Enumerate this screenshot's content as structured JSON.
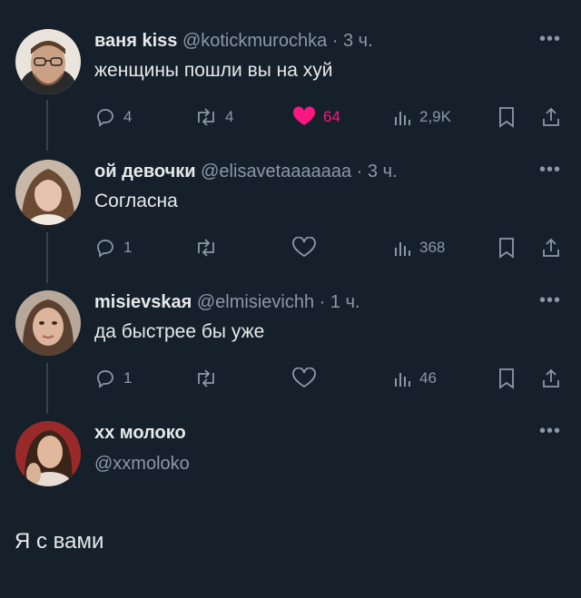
{
  "colors": {
    "background": "#15202b",
    "text": "#e7e9ea",
    "muted": "#8b98a5",
    "like": "#f91880",
    "line": "#38444d"
  },
  "tweets": [
    {
      "name": "ваня kiss",
      "handle": "@kotickmurochka",
      "time": "· 3 ч.",
      "text": "женщины пошли вы на хуй",
      "replies": "4",
      "retweets": "4",
      "likes": "64",
      "views": "2,9K",
      "liked": true
    },
    {
      "name": "ой девочки",
      "handle": "@elisavetaaaaaaa",
      "time": "· 3 ч.",
      "text": "Согласна",
      "replies": "1",
      "retweets": "",
      "likes": "",
      "views": "368"
    },
    {
      "name": "misievskaя",
      "handle": "@elmisievichh",
      "time": "· 1 ч.",
      "text": "да быстрее бы уже",
      "replies": "1",
      "retweets": "",
      "likes": "",
      "views": "46"
    }
  ],
  "main_tweet": {
    "name": "хх молоко",
    "handle": "@xxmoloko",
    "text": "Я с вами"
  },
  "icons": {
    "reply": "reply-icon",
    "retweet": "retweet-icon",
    "like": "heart-icon",
    "views": "views-icon",
    "bookmark": "bookmark-icon",
    "share": "share-icon",
    "more": "more-icon"
  }
}
